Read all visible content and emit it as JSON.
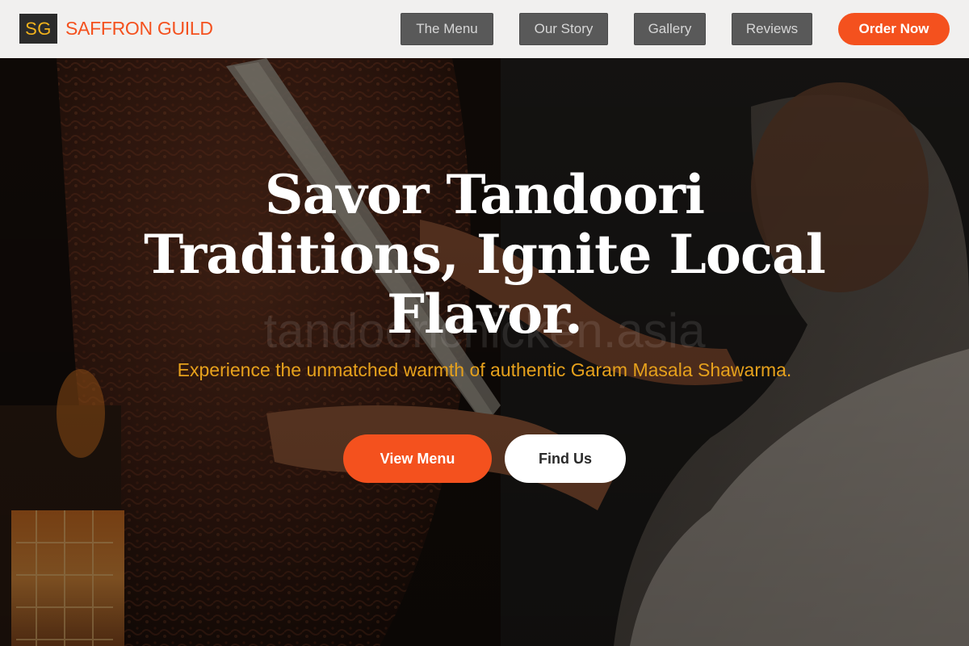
{
  "brand": {
    "badge": "SG",
    "name": "SAFFRON GUILD"
  },
  "nav": {
    "links": [
      "The Menu",
      "Our Story",
      "Gallery",
      "Reviews"
    ],
    "cta": "Order Now"
  },
  "hero": {
    "title": "Savor Tandoori Traditions, Ignite Local Flavor.",
    "subtitle": "Experience the unmatched warmth of authentic Garam Masala Shawarma.",
    "watermark": "tandoorichicken.asia",
    "primary_button": "View Menu",
    "secondary_button": "Find Us",
    "background_image": "chef slicing shawarma meat with a long knife"
  },
  "colors": {
    "accent": "#f4511e",
    "badge_text": "#f2b21c",
    "subtitle": "#e6a11c",
    "nav_bg": "#f1f0ef",
    "nav_link_bg": "#595959"
  }
}
